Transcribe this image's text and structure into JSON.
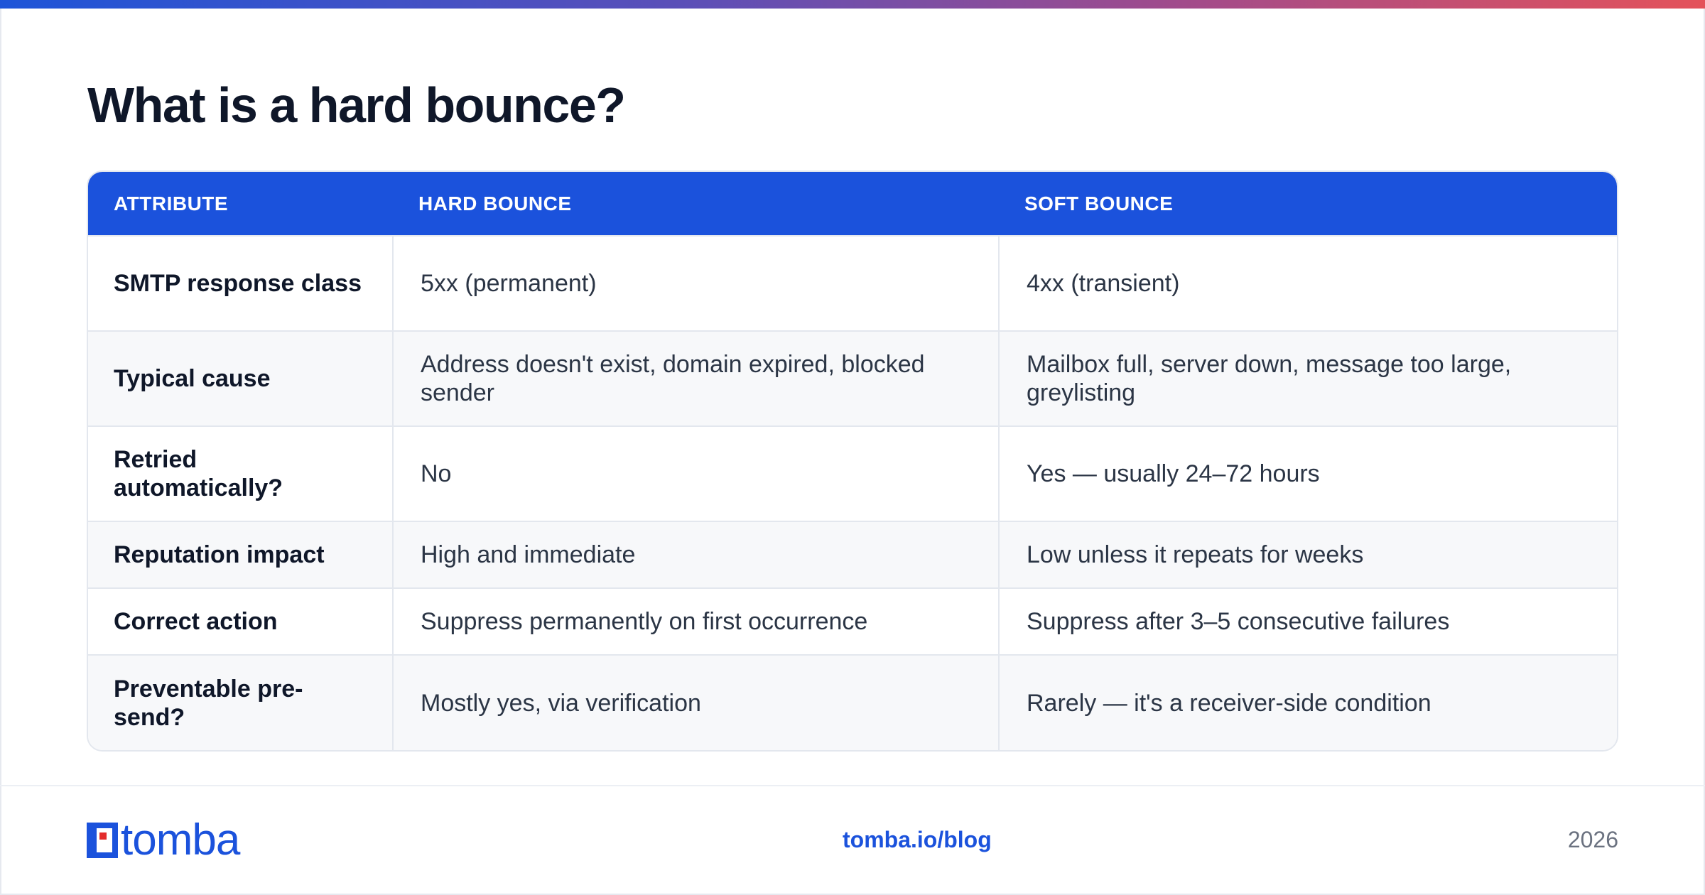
{
  "page": {
    "title": "What is a hard bounce?"
  },
  "table": {
    "headers": [
      "ATTRIBUTE",
      "HARD BOUNCE",
      "SOFT BOUNCE"
    ],
    "rows": [
      [
        "SMTP response class",
        "5xx (permanent)",
        "4xx (transient)"
      ],
      [
        "Typical cause",
        "Address doesn't exist, domain expired, blocked sender",
        "Mailbox full, server down, message too large, greylisting"
      ],
      [
        "Retried automatically?",
        "No",
        "Yes — usually 24–72 hours"
      ],
      [
        "Reputation impact",
        "High and immediate",
        "Low unless it repeats for weeks"
      ],
      [
        "Correct action",
        "Suppress permanently on first occurrence",
        "Suppress after 3–5 consecutive failures"
      ],
      [
        "Preventable pre-send?",
        "Mostly yes, via verification",
        "Rarely — it's a receiver-side condition"
      ]
    ]
  },
  "footer": {
    "brand": "tomba",
    "link": "tomba.io/blog",
    "year": "2026"
  },
  "colors": {
    "accent": "#1b52dc",
    "logo_red": "#e32b2b",
    "title": "#0f1729"
  },
  "icons": {
    "logo": "tomba-logo-icon"
  }
}
